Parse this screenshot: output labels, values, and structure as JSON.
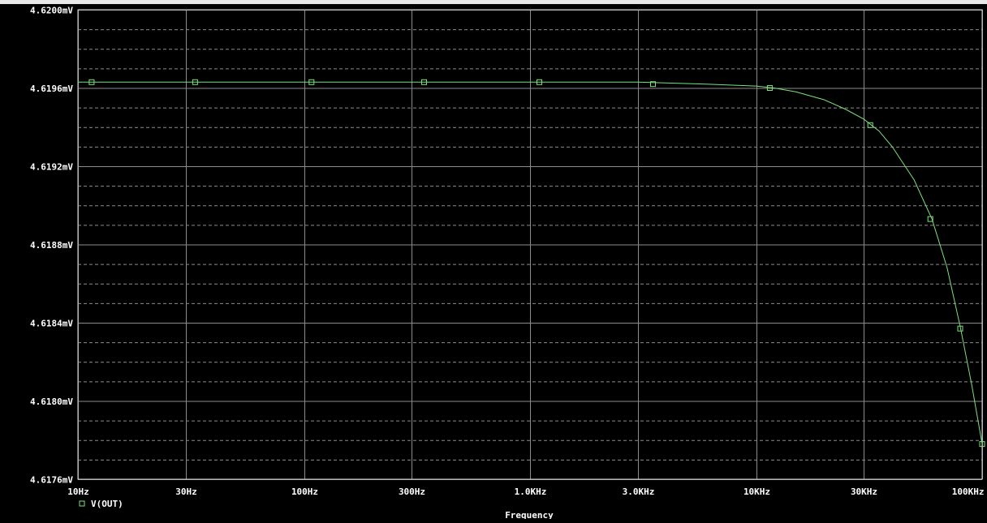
{
  "chart_data": {
    "type": "line",
    "xlabel": "Frequency",
    "ylabel": "",
    "x_scale": "log",
    "xlim": [
      10,
      100000
    ],
    "ylim": [
      4.6176,
      4.62
    ],
    "y_unit": "mV",
    "x_ticks": [
      {
        "value": 10,
        "label": "10Hz"
      },
      {
        "value": 30,
        "label": "30Hz"
      },
      {
        "value": 100,
        "label": "100Hz"
      },
      {
        "value": 300,
        "label": "300Hz"
      },
      {
        "value": 1000,
        "label": "1.0KHz"
      },
      {
        "value": 3000,
        "label": "3.0KHz"
      },
      {
        "value": 10000,
        "label": "10KHz"
      },
      {
        "value": 30000,
        "label": "30KHz"
      },
      {
        "value": 100000,
        "label": "100KHz"
      }
    ],
    "y_ticks": [
      {
        "value": 4.62,
        "label": "4.6200mV"
      },
      {
        "value": 4.6196,
        "label": "4.6196mV"
      },
      {
        "value": 4.6192,
        "label": "4.6192mV"
      },
      {
        "value": 4.6188,
        "label": "4.6188mV"
      },
      {
        "value": 4.6184,
        "label": "4.6184mV"
      },
      {
        "value": 4.618,
        "label": "4.6180mV"
      },
      {
        "value": 4.6176,
        "label": "4.6176mV"
      }
    ],
    "y_minor_ticks": [
      4.6199,
      4.6198,
      4.6197,
      4.6195,
      4.6194,
      4.6193,
      4.6191,
      4.619,
      4.6189,
      4.6187,
      4.6186,
      4.6185,
      4.6183,
      4.6182,
      4.6181,
      4.6179,
      4.6178,
      4.6177
    ],
    "grid": true,
    "legend_placement": "bottom-left",
    "series": [
      {
        "name": "V(OUT)",
        "color": "#7ee07e",
        "marker": "square",
        "curve": [
          {
            "x": 10,
            "y": 4.61963
          },
          {
            "x": 100,
            "y": 4.61963
          },
          {
            "x": 1000,
            "y": 4.61963
          },
          {
            "x": 3000,
            "y": 4.61963
          },
          {
            "x": 6000,
            "y": 4.61962
          },
          {
            "x": 10000,
            "y": 4.61961
          },
          {
            "x": 12000,
            "y": 4.6196
          },
          {
            "x": 15000,
            "y": 4.61958
          },
          {
            "x": 20000,
            "y": 4.61954
          },
          {
            "x": 25000,
            "y": 4.61949
          },
          {
            "x": 30000,
            "y": 4.61944
          },
          {
            "x": 35000,
            "y": 4.61938
          },
          {
            "x": 40000,
            "y": 4.6193
          },
          {
            "x": 50000,
            "y": 4.61913
          },
          {
            "x": 60000,
            "y": 4.61893
          },
          {
            "x": 70000,
            "y": 4.61868
          },
          {
            "x": 80000,
            "y": 4.61838
          },
          {
            "x": 90000,
            "y": 4.61808
          },
          {
            "x": 100000,
            "y": 4.61778
          }
        ],
        "markers": [
          {
            "x": 11.5,
            "y": 4.61963
          },
          {
            "x": 33,
            "y": 4.61963
          },
          {
            "x": 108,
            "y": 4.61963
          },
          {
            "x": 340,
            "y": 4.61963
          },
          {
            "x": 1100,
            "y": 4.61963
          },
          {
            "x": 3500,
            "y": 4.61962
          },
          {
            "x": 11500,
            "y": 4.6196
          },
          {
            "x": 32000,
            "y": 4.61941
          },
          {
            "x": 59000,
            "y": 4.61893
          },
          {
            "x": 80000,
            "y": 4.61837
          },
          {
            "x": 100000,
            "y": 4.61778
          }
        ]
      }
    ]
  },
  "colors": {
    "background": "#000000",
    "text": "#ffffff",
    "axis": "#d8d8d8",
    "grid": "#8c8c8c",
    "trace": "#7ee07e"
  }
}
